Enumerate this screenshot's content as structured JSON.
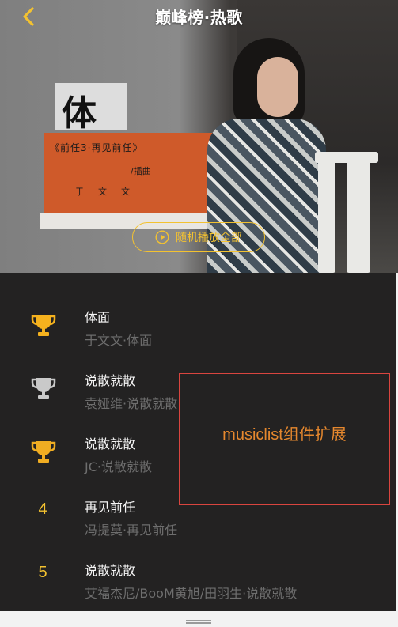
{
  "header": {
    "title": "巅峰榜·热歌",
    "back_icon": "chevron-left-icon",
    "accent_color": "#f3c230"
  },
  "hero": {
    "poster_glyph": "体",
    "poster_line1": "《前任3·再见前任》",
    "poster_line2": "/插曲",
    "poster_line3": "于文文",
    "play_all_label": "随机播放全部",
    "play_icon": "play-circle-icon"
  },
  "songs": [
    {
      "rank": "1",
      "rank_icon": "trophy-gold-icon",
      "title": "体面",
      "artist": "于文文·体面"
    },
    {
      "rank": "2",
      "rank_icon": "trophy-silver-icon",
      "title": "说散就散",
      "artist": "袁娅维·说散就散"
    },
    {
      "rank": "3",
      "rank_icon": "trophy-bronze-icon",
      "title": "说散就散",
      "artist": "JC·说散就散"
    },
    {
      "rank": "4",
      "title": "再见前任",
      "artist": "冯提莫·再见前任"
    },
    {
      "rank": "5",
      "title": "说散就散",
      "artist": "艾福杰尼/BooM黄旭/田羽生·说散就散"
    }
  ],
  "extension_note": "musiclist组件扩展",
  "colors": {
    "list_bg": "#232222",
    "rank_gold": "#f3c230",
    "note_border": "#d9453f",
    "note_text": "#e6882e"
  }
}
